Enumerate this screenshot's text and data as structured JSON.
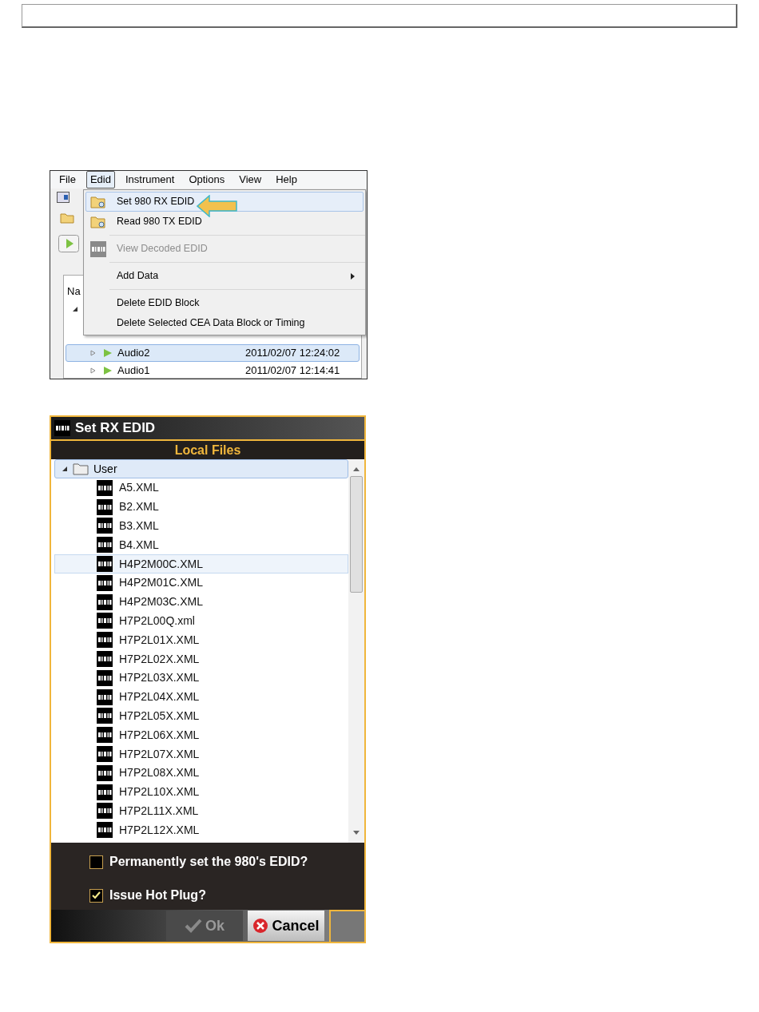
{
  "app_window": {
    "menu_bar": [
      {
        "label": "File",
        "selected": false
      },
      {
        "label": "Edid",
        "selected": true
      },
      {
        "label": "Instrument",
        "selected": false
      },
      {
        "label": "Options",
        "selected": false
      },
      {
        "label": "View",
        "selected": false
      },
      {
        "label": "Help",
        "selected": false
      }
    ],
    "column_header": "Na",
    "rows": [
      {
        "name": "Audio2",
        "date": "2011/02/07 12:24:02",
        "selected": true
      },
      {
        "name": "Audio1",
        "date": "2011/02/07 12:14:41",
        "selected": false
      }
    ],
    "menu": [
      {
        "kind": "folder_item",
        "label": "Set 980 RX EDID",
        "disabled": false,
        "highlighted": true,
        "submenu": false
      },
      {
        "kind": "folder_item",
        "label": "Read 980 TX EDID",
        "disabled": false,
        "highlighted": false,
        "submenu": false
      },
      {
        "kind": "separator"
      },
      {
        "kind": "edid_item",
        "label": "View Decoded EDID",
        "disabled": true,
        "highlighted": false,
        "submenu": false
      },
      {
        "kind": "separator"
      },
      {
        "kind": "item",
        "label": "Add Data",
        "disabled": false,
        "highlighted": false,
        "submenu": true
      },
      {
        "kind": "separator"
      },
      {
        "kind": "item",
        "label": "Delete EDID Block",
        "disabled": false,
        "highlighted": false,
        "submenu": false
      },
      {
        "kind": "item",
        "label": "Delete Selected CEA Data Block or Timing",
        "disabled": false,
        "highlighted": false,
        "submenu": false
      }
    ]
  },
  "dialog": {
    "title": "Set RX EDID",
    "section": "Local Files",
    "folder": {
      "name": "User",
      "expanded": true,
      "selected": true
    },
    "files": [
      {
        "name": "A5.XML",
        "selected": false
      },
      {
        "name": "B2.XML",
        "selected": false
      },
      {
        "name": "B3.XML",
        "selected": false
      },
      {
        "name": "B4.XML",
        "selected": false
      },
      {
        "name": "H4P2M00C.XML",
        "selected": true
      },
      {
        "name": "H4P2M01C.XML",
        "selected": false
      },
      {
        "name": "H4P2M03C.XML",
        "selected": false
      },
      {
        "name": "H7P2L00Q.xml",
        "selected": false
      },
      {
        "name": "H7P2L01X.XML",
        "selected": false
      },
      {
        "name": "H7P2L02X.XML",
        "selected": false
      },
      {
        "name": "H7P2L03X.XML",
        "selected": false
      },
      {
        "name": "H7P2L04X.XML",
        "selected": false
      },
      {
        "name": "H7P2L05X.XML",
        "selected": false
      },
      {
        "name": "H7P2L06X.XML",
        "selected": false
      },
      {
        "name": "H7P2L07X.XML",
        "selected": false
      },
      {
        "name": "H7P2L08X.XML",
        "selected": false
      },
      {
        "name": "H7P2L10X.XML",
        "selected": false
      },
      {
        "name": "H7P2L11X.XML",
        "selected": false
      },
      {
        "name": "H7P2L12X.XML",
        "selected": false
      }
    ],
    "options": [
      {
        "label": "Permanently set the 980's EDID?",
        "checked": false
      },
      {
        "label": "Issue Hot Plug?",
        "checked": true
      }
    ],
    "buttons": [
      {
        "kind": "ok",
        "label": "Ok",
        "disabled": true
      },
      {
        "kind": "cancel",
        "label": "Cancel",
        "disabled": false
      }
    ]
  }
}
